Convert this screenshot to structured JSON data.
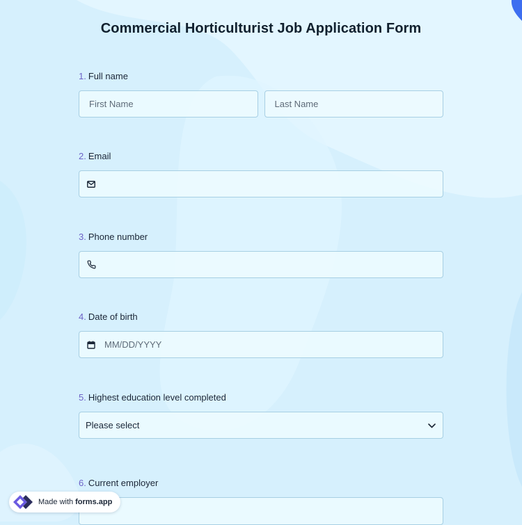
{
  "form": {
    "title": "Commercial Horticulturist Job Application Form",
    "questions": [
      {
        "number": "1.",
        "label": "Full name",
        "first_placeholder": "First Name",
        "last_placeholder": "Last Name"
      },
      {
        "number": "2.",
        "label": "Email",
        "icon": "mail-icon"
      },
      {
        "number": "3.",
        "label": "Phone number",
        "icon": "phone-icon"
      },
      {
        "number": "4.",
        "label": "Date of birth",
        "icon": "calendar-icon",
        "placeholder": "MM/DD/YYYY"
      },
      {
        "number": "5.",
        "label": "Highest education level completed",
        "selected": "Please select",
        "icon": "chevron-down-icon"
      },
      {
        "number": "6.",
        "label": "Current employer"
      }
    ]
  },
  "badge": {
    "made_with": "Made with",
    "brand": "forms.app"
  },
  "colors": {
    "background": "#d6f0fd",
    "question_number": "#6e63c7",
    "input_border": "#a7cfe3",
    "accent_blob": "#3d6ef0"
  }
}
